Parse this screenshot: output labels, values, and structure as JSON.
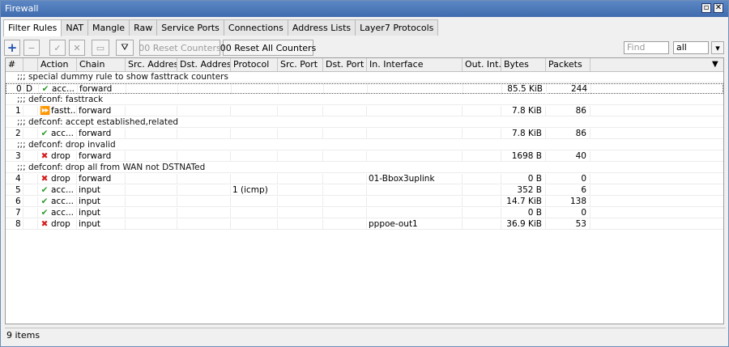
{
  "window": {
    "title": "Firewall"
  },
  "tabs": [
    "Filter Rules",
    "NAT",
    "Mangle",
    "Raw",
    "Service Ports",
    "Connections",
    "Address Lists",
    "Layer7 Protocols"
  ],
  "toolbar": {
    "add": "+",
    "remove": "−",
    "enable": "✓",
    "disable": "✕",
    "comment": "▭",
    "filter": "⛛",
    "reset_counters": "00 Reset Counters",
    "reset_all_counters": "00 Reset All Counters",
    "find_placeholder": "Find",
    "filter_value": "all",
    "dropdown_arrow": "▾"
  },
  "columns": [
    "#",
    "",
    "Action",
    "Chain",
    "Src. Address",
    "Dst. Address",
    "Protocol",
    "Src. Port",
    "Dst. Port",
    "In. Interface",
    "Out. Int...",
    "Bytes",
    "Packets"
  ],
  "comments": [
    ";;; special dummy rule to show fasttrack counters",
    ";;; defconf: fasttrack",
    ";;; defconf: accept established,related",
    ";;; defconf: drop invalid",
    ";;; defconf:  drop all from WAN not DSTNATed"
  ],
  "rules": [
    {
      "num": "0",
      "flag": "D",
      "action": "acc...",
      "action_type": "accept",
      "chain": "forward",
      "protocol": "",
      "in_interface": "",
      "bytes": "85.5 KiB",
      "packets": "244"
    },
    {
      "num": "1",
      "flag": "",
      "action": "fastt...",
      "action_type": "fasttrack",
      "chain": "forward",
      "protocol": "",
      "in_interface": "",
      "bytes": "7.8 KiB",
      "packets": "86"
    },
    {
      "num": "2",
      "flag": "",
      "action": "acc...",
      "action_type": "accept",
      "chain": "forward",
      "protocol": "",
      "in_interface": "",
      "bytes": "7.8 KiB",
      "packets": "86"
    },
    {
      "num": "3",
      "flag": "",
      "action": "drop",
      "action_type": "drop",
      "chain": "forward",
      "protocol": "",
      "in_interface": "",
      "bytes": "1698 B",
      "packets": "40"
    },
    {
      "num": "4",
      "flag": "",
      "action": "drop",
      "action_type": "drop",
      "chain": "forward",
      "protocol": "",
      "in_interface": "01-Bbox3uplink",
      "bytes": "0 B",
      "packets": "0"
    },
    {
      "num": "5",
      "flag": "",
      "action": "acc...",
      "action_type": "accept",
      "chain": "input",
      "protocol": "1 (icmp)",
      "in_interface": "",
      "bytes": "352 B",
      "packets": "6"
    },
    {
      "num": "6",
      "flag": "",
      "action": "acc...",
      "action_type": "accept",
      "chain": "input",
      "protocol": "",
      "in_interface": "",
      "bytes": "14.7 KiB",
      "packets": "138"
    },
    {
      "num": "7",
      "flag": "",
      "action": "acc...",
      "action_type": "accept",
      "chain": "input",
      "protocol": "",
      "in_interface": "",
      "bytes": "0 B",
      "packets": "0"
    },
    {
      "num": "8",
      "flag": "",
      "action": "drop",
      "action_type": "drop",
      "chain": "input",
      "protocol": "",
      "in_interface": "pppoe-out1",
      "bytes": "36.9 KiB",
      "packets": "53"
    }
  ],
  "icons": {
    "accept": "✔",
    "drop": "✖",
    "fasttrack": "⏩"
  },
  "colors": {
    "accept": "#2e9b2e",
    "drop": "#d42020",
    "fasttrack": "#3a7fd8",
    "add": "#1f4fb0"
  },
  "status": {
    "items": "9 items"
  }
}
